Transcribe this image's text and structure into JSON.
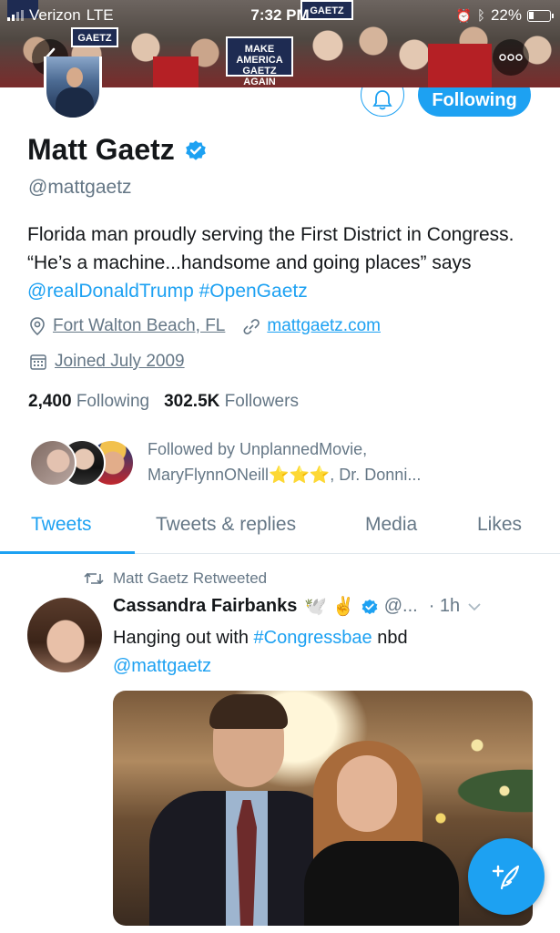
{
  "status_bar": {
    "carrier": "Verizon",
    "network": "LTE",
    "time": "7:32 PM",
    "battery": "22%"
  },
  "header": {
    "back_icon": "chevron-left-icon",
    "more_icon": "more-horizontal-icon",
    "banner_sign_1": "GAETZ",
    "banner_sign_2": "MAKE AMERICA GAETZ AGAIN"
  },
  "actions": {
    "bell_icon": "notification-bell-icon",
    "following_label": "Following"
  },
  "profile": {
    "name": "Matt Gaetz",
    "verified": true,
    "handle": "@mattgaetz",
    "bio_part1": "Florida man proudly serving the First District in Congress. “He’s a machine...handsome and going places” says ",
    "bio_mention": "@realDonaldTrump",
    "bio_hashtag": "#OpenGaetz",
    "location": "Fort Walton Beach, FL",
    "website": "mattgaetz.com",
    "joined": "Joined July 2009",
    "following_count": "2,400",
    "following_label": "Following",
    "followers_count": "302.5K",
    "followers_label": "Followers",
    "followed_by_text": "Followed by UnplannedMovie, MaryFlynnONeill",
    "followed_by_stars": "⭐⭐⭐",
    "followed_by_rest": ", Dr. Donni..."
  },
  "tabs": [
    {
      "label": "Tweets",
      "active": true
    },
    {
      "label": "Tweets & replies",
      "active": false
    },
    {
      "label": "Media",
      "active": false
    },
    {
      "label": "Likes",
      "active": false
    }
  ],
  "tweet": {
    "retweet_label": "Matt Gaetz Retweeted",
    "author_name": "Cassandra Fairbanks",
    "author_emojis": "🕊️ ✌️",
    "author_handle": "@...",
    "time": "· 1h",
    "text_part1": "Hanging out with ",
    "text_hashtag": "#Congressbae",
    "text_part2": " nbd",
    "text_mention": "@mattgaetz"
  },
  "fab": {
    "icon": "compose-tweet-icon"
  },
  "colors": {
    "accent": "#1da1f2",
    "text": "#14171a",
    "secondary": "#657786"
  }
}
